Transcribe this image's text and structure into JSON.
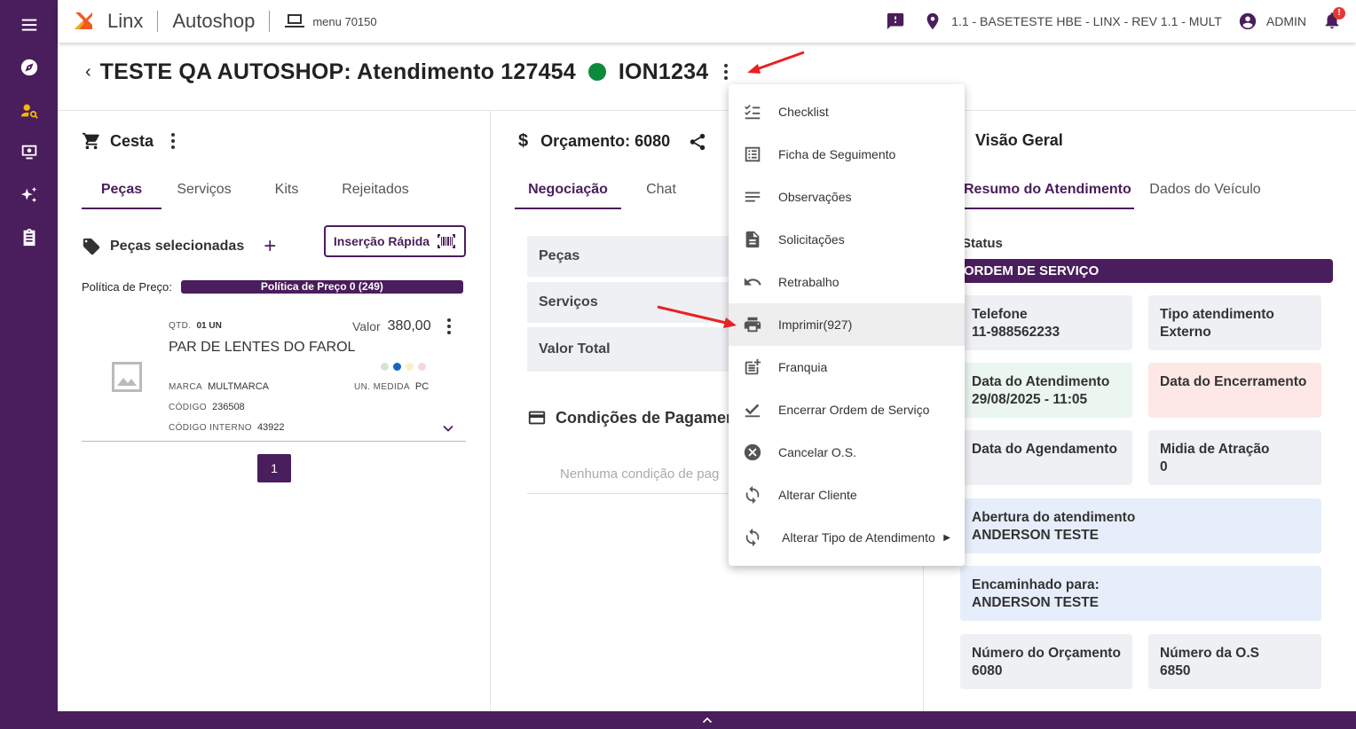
{
  "topbar": {
    "brand": "Linx",
    "product": "Autoshop",
    "menu_label": "menu 70150",
    "location": "1.1 - BASETESTE HBE - LINX - REV 1.1 - MULT",
    "user": "ADMIN",
    "notification_badge": "!"
  },
  "sidebar": {
    "items": [
      {
        "icon": "menu-icon"
      },
      {
        "icon": "compass-icon"
      },
      {
        "icon": "person-search-icon"
      },
      {
        "icon": "monitor-icon"
      },
      {
        "icon": "sparkles-icon"
      },
      {
        "icon": "clipboard-icon"
      }
    ]
  },
  "header": {
    "back": "‹",
    "title": "TESTE QA AUTOSHOP: Atendimento 127454",
    "plate": "ION1234",
    "status_color": "#0d8a3c"
  },
  "cesta": {
    "title": "Cesta",
    "tabs": [
      "Peças",
      "Serviços",
      "Kits",
      "Rejeitados"
    ],
    "selected_title": "Peças selecionadas",
    "add": "+",
    "quick_insert": "Inserção Rápida",
    "price_policy_label": "Política de Preço:",
    "price_policy_value": "Política de Preço 0 (249)",
    "item": {
      "qty_label": "QTD.",
      "qty_value": "01 UN",
      "value_label": "Valor",
      "value": "380,00",
      "name": "PAR DE LENTES DO FAROL",
      "brand_label": "MARCA",
      "brand_value": "MULTMARCA",
      "code_label": "CÓDIGO",
      "code_value": "236508",
      "internal_label": "CÓDIGO INTERNO",
      "internal_value": "43922",
      "unit_label": "UN. MEDIDA",
      "unit_value": "PC"
    },
    "page": "1"
  },
  "orcamento": {
    "title": "Orçamento: 6080",
    "tabs": [
      "Negociação",
      "Chat"
    ],
    "rows": [
      "Peças",
      "Serviços",
      "Valor Total"
    ],
    "payment_title": "Condições de Pagament",
    "payment_empty": "Nenhuma condição de pag"
  },
  "visao": {
    "title": "Visão Geral",
    "tabs": [
      "Resumo do Atendimento",
      "Dados do Veículo"
    ],
    "status_label": "Status",
    "status_value": "ORDEM DE SERVIÇO",
    "cards": [
      {
        "label": "Telefone",
        "value": "11-988562233",
        "color": "#eef0f4"
      },
      {
        "label": "Tipo atendimento",
        "value": "Externo",
        "color": "#eef0f4"
      },
      {
        "label": "Data do Atendimento",
        "value": "29/08/2025 - 11:05",
        "color": "#eaf6ef"
      },
      {
        "label": "Data do Encerramento",
        "value": "",
        "color": "#fde8e6"
      },
      {
        "label": "Data do Agendamento",
        "value": "",
        "color": "#eef0f4"
      },
      {
        "label": "Midia de Atração",
        "value": "0",
        "color": "#eef0f4"
      },
      {
        "label": "Abertura do atendimento",
        "value": "ANDERSON TESTE",
        "color": "#e7eefb"
      },
      {
        "label": "Encaminhado para:",
        "value": "ANDERSON TESTE",
        "color": "#e7eefb"
      },
      {
        "label": "Número do Orçamento",
        "value": "6080",
        "color": "#eef0f4"
      },
      {
        "label": "Número da O.S",
        "value": "6850",
        "color": "#eef0f4"
      }
    ]
  },
  "menu": {
    "items": [
      {
        "label": "Checklist",
        "icon": "checklist-icon"
      },
      {
        "label": "Ficha de Seguimento",
        "icon": "list-alt-icon"
      },
      {
        "label": "Observações",
        "icon": "notes-icon"
      },
      {
        "label": "Solicitações",
        "icon": "document-icon"
      },
      {
        "label": "Retrabalho",
        "icon": "undo-icon"
      },
      {
        "label": "Imprimir(927)",
        "icon": "print-icon"
      },
      {
        "label": "Franquia",
        "icon": "post-add-icon"
      },
      {
        "label": "Encerrar Ordem de Serviço",
        "icon": "check-icon"
      },
      {
        "label": "Cancelar O.S.",
        "icon": "cancel-icon"
      },
      {
        "label": "Alterar Cliente",
        "icon": "sync-icon"
      },
      {
        "label": "Alterar Tipo de Atendimento",
        "icon": "sync-icon"
      }
    ]
  },
  "colors": {
    "primary": "#4a1d5c",
    "annotation_arrow": "#e82121"
  }
}
